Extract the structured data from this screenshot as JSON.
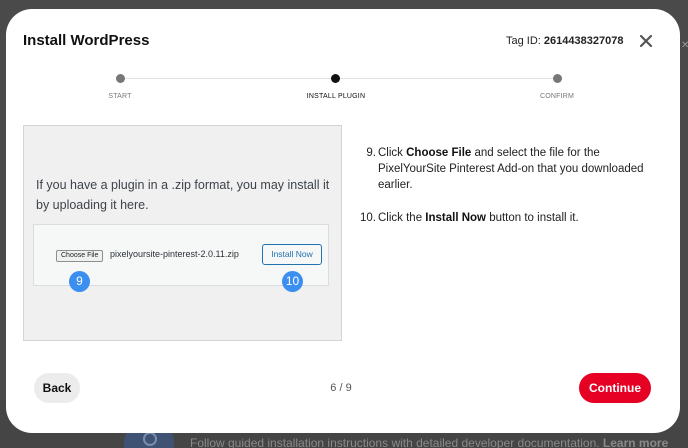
{
  "background": {
    "text": "Follow guided installation instructions with detailed developer documentation.",
    "link": "Learn more"
  },
  "modal": {
    "title": "Install WordPress",
    "tag_label": "Tag ID:",
    "tag_id": "2614438327078",
    "close_icon": "close-icon"
  },
  "stepper": {
    "current": 2,
    "steps": [
      {
        "label": "START"
      },
      {
        "label": "INSTALL PLUGIN"
      },
      {
        "label": "CONFIRM"
      }
    ]
  },
  "illustration": {
    "text": "If you have a plugin in a .zip format, you may install it by uploading it here.",
    "choose_file": "Choose File",
    "file_name": "pixelyoursite-pinterest-2.0.11.zip",
    "install_now": "Install Now",
    "badge_1": "9",
    "badge_2": "10"
  },
  "instructions": [
    {
      "num": "9.",
      "pre": "Click ",
      "bold": "Choose File",
      "post": " and select the file for the PixelYourSite Pinterest Add-on that you downloaded earlier."
    },
    {
      "num": "10.",
      "pre": "Click the ",
      "bold": "Install Now",
      "post": " button to install it."
    }
  ],
  "footer": {
    "back": "Back",
    "page": "6 / 9",
    "continue": "Continue"
  },
  "colors": {
    "primary": "#e60023",
    "badge": "#3a8ff0",
    "wp_link": "#2271b1"
  }
}
